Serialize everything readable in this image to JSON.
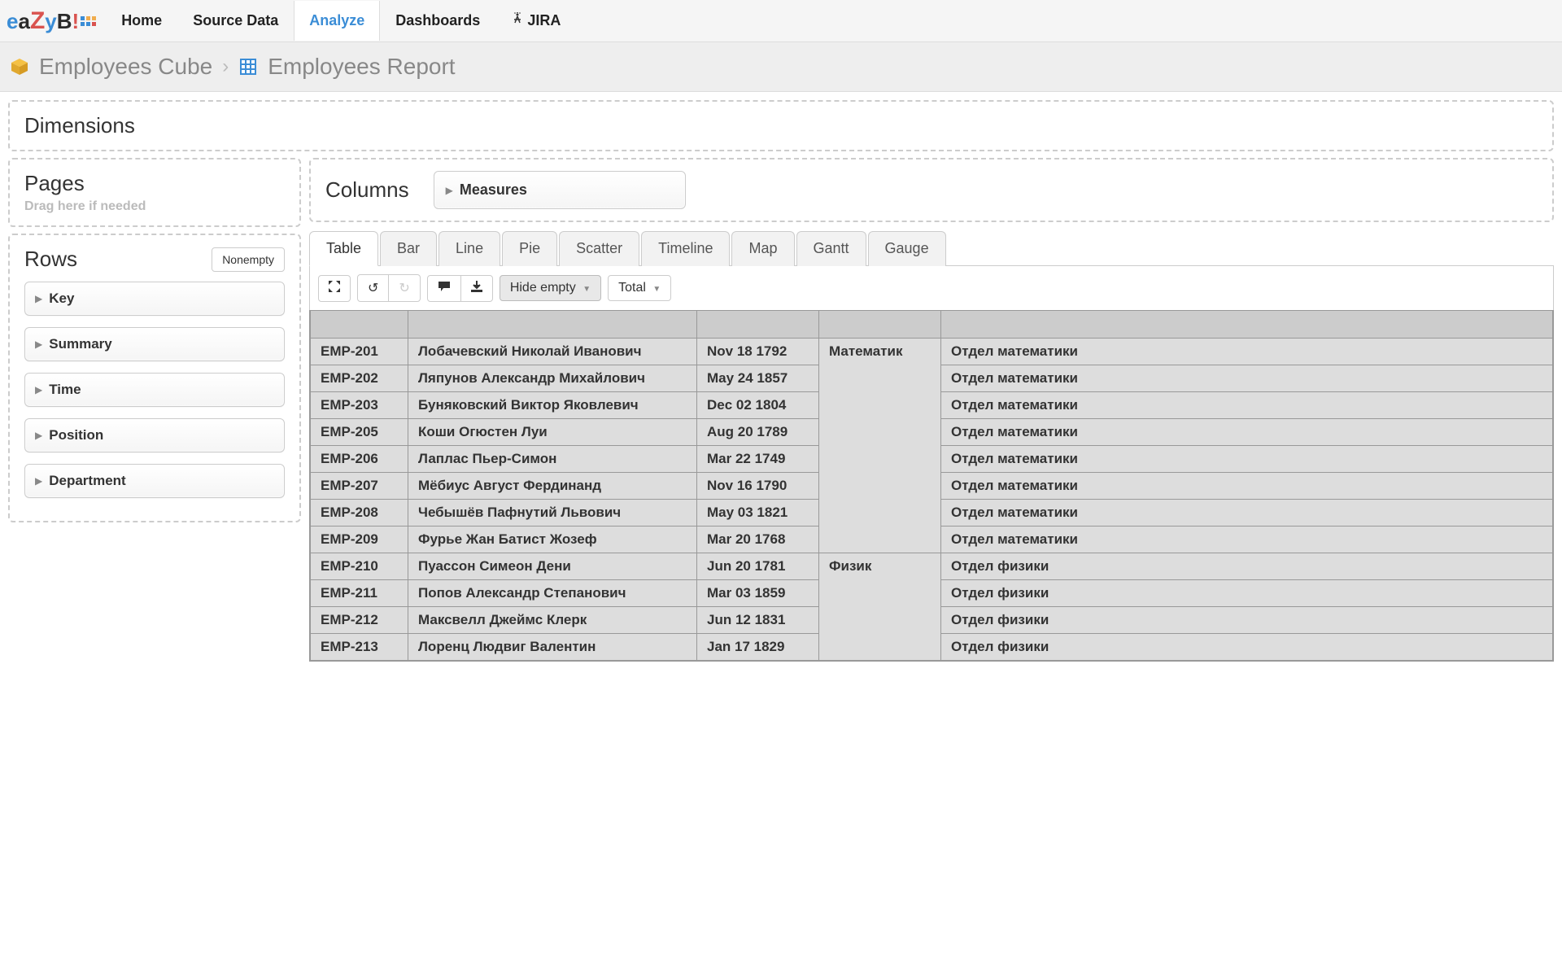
{
  "nav": {
    "items": [
      "Home",
      "Source Data",
      "Analyze",
      "Dashboards",
      "JIRA"
    ],
    "active": "Analyze"
  },
  "breadcrumb": {
    "cube": "Employees Cube",
    "report": "Employees Report"
  },
  "dimensions": {
    "title": "Dimensions"
  },
  "pages": {
    "title": "Pages",
    "hint": "Drag here if needed"
  },
  "rows": {
    "title": "Rows",
    "nonempty": "Nonempty",
    "items": [
      "Key",
      "Summary",
      "Time",
      "Position",
      "Department"
    ]
  },
  "columns": {
    "title": "Columns",
    "measures": "Measures"
  },
  "tabs": [
    "Table",
    "Bar",
    "Line",
    "Pie",
    "Scatter",
    "Timeline",
    "Map",
    "Gantt",
    "Gauge"
  ],
  "active_tab": "Table",
  "toolbar": {
    "hide_empty": "Hide empty",
    "total": "Total"
  },
  "table": {
    "rows": [
      {
        "key": "EMP-201",
        "name": "Лобачевский Николай Иванович",
        "date": "Nov 18 1792",
        "pos": "Математик",
        "dept": "Отдел математики"
      },
      {
        "key": "EMP-202",
        "name": "Ляпунов Александр Михайлович",
        "date": "May 24 1857",
        "pos": "",
        "dept": "Отдел математики"
      },
      {
        "key": "EMP-203",
        "name": "Буняковский Виктор Яковлевич",
        "date": "Dec 02 1804",
        "pos": "",
        "dept": "Отдел математики"
      },
      {
        "key": "EMP-205",
        "name": "Коши Огюстен Луи",
        "date": "Aug 20 1789",
        "pos": "",
        "dept": "Отдел математики"
      },
      {
        "key": "EMP-206",
        "name": "Лаплас Пьер-Симон",
        "date": "Mar 22 1749",
        "pos": "",
        "dept": "Отдел математики"
      },
      {
        "key": "EMP-207",
        "name": "Мёбиус Август Фердинанд",
        "date": "Nov 16 1790",
        "pos": "",
        "dept": "Отдел математики"
      },
      {
        "key": "EMP-208",
        "name": "Чебышёв Пафнутий Львович",
        "date": "May 03 1821",
        "pos": "",
        "dept": "Отдел математики"
      },
      {
        "key": "EMP-209",
        "name": "Фурье Жан Батист Жозеф",
        "date": "Mar 20 1768",
        "pos": "",
        "dept": "Отдел математики"
      },
      {
        "key": "EMP-210",
        "name": "Пуассон Симеон Дени",
        "date": "Jun 20 1781",
        "pos": "Физик",
        "dept": "Отдел физики"
      },
      {
        "key": "EMP-211",
        "name": "Попов Александр Степанович",
        "date": "Mar 03 1859",
        "pos": "",
        "dept": "Отдел физики"
      },
      {
        "key": "EMP-212",
        "name": "Максвелл Джеймс Клерк",
        "date": "Jun 12 1831",
        "pos": "",
        "dept": "Отдел физики"
      },
      {
        "key": "EMP-213",
        "name": "Лоренц Людвиг Валентин",
        "date": "Jan 17 1829",
        "pos": "",
        "dept": "Отдел физики"
      }
    ],
    "pos_groups": [
      {
        "start": 0,
        "span": 8,
        "label": "Математик"
      },
      {
        "start": 8,
        "span": 4,
        "label": "Физик"
      }
    ]
  }
}
